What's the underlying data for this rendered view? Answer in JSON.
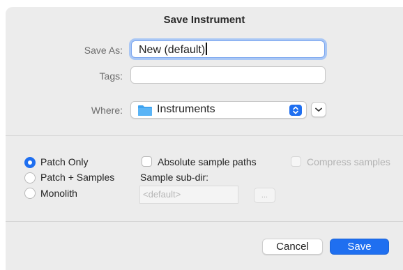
{
  "window": {
    "title": "Save Instrument"
  },
  "form": {
    "save_as": {
      "label": "Save As:",
      "value": "New (default)"
    },
    "tags": {
      "label": "Tags:",
      "value": ""
    },
    "where": {
      "label": "Where:",
      "value": "Instruments"
    }
  },
  "export_mode": {
    "options": [
      {
        "label": "Patch Only",
        "selected": true
      },
      {
        "label": "Patch + Samples",
        "selected": false
      },
      {
        "label": "Monolith",
        "selected": false
      }
    ]
  },
  "options": {
    "absolute_paths": {
      "label": "Absolute sample paths",
      "checked": false
    },
    "compress": {
      "label": "Compress samples",
      "checked": false,
      "enabled": false
    },
    "subdir": {
      "label": "Sample sub-dir:",
      "placeholder": "<default>",
      "browse_label": "..."
    }
  },
  "buttons": {
    "cancel": "Cancel",
    "save": "Save"
  },
  "colors": {
    "accent": "#1f6ff0",
    "dialog_bg": "#ececec",
    "focus_ring": "#a9c7f5"
  }
}
